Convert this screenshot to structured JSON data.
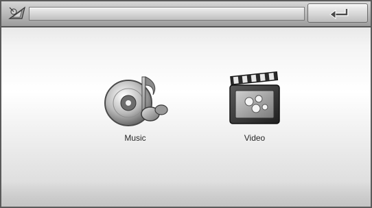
{
  "header": {
    "logo_icon": "satellite-icon",
    "back_icon": "return-arrow-icon"
  },
  "menu": {
    "items": [
      {
        "label": "Music",
        "icon": "music-disc-icon"
      },
      {
        "label": "Video",
        "icon": "video-clapper-icon"
      }
    ]
  }
}
